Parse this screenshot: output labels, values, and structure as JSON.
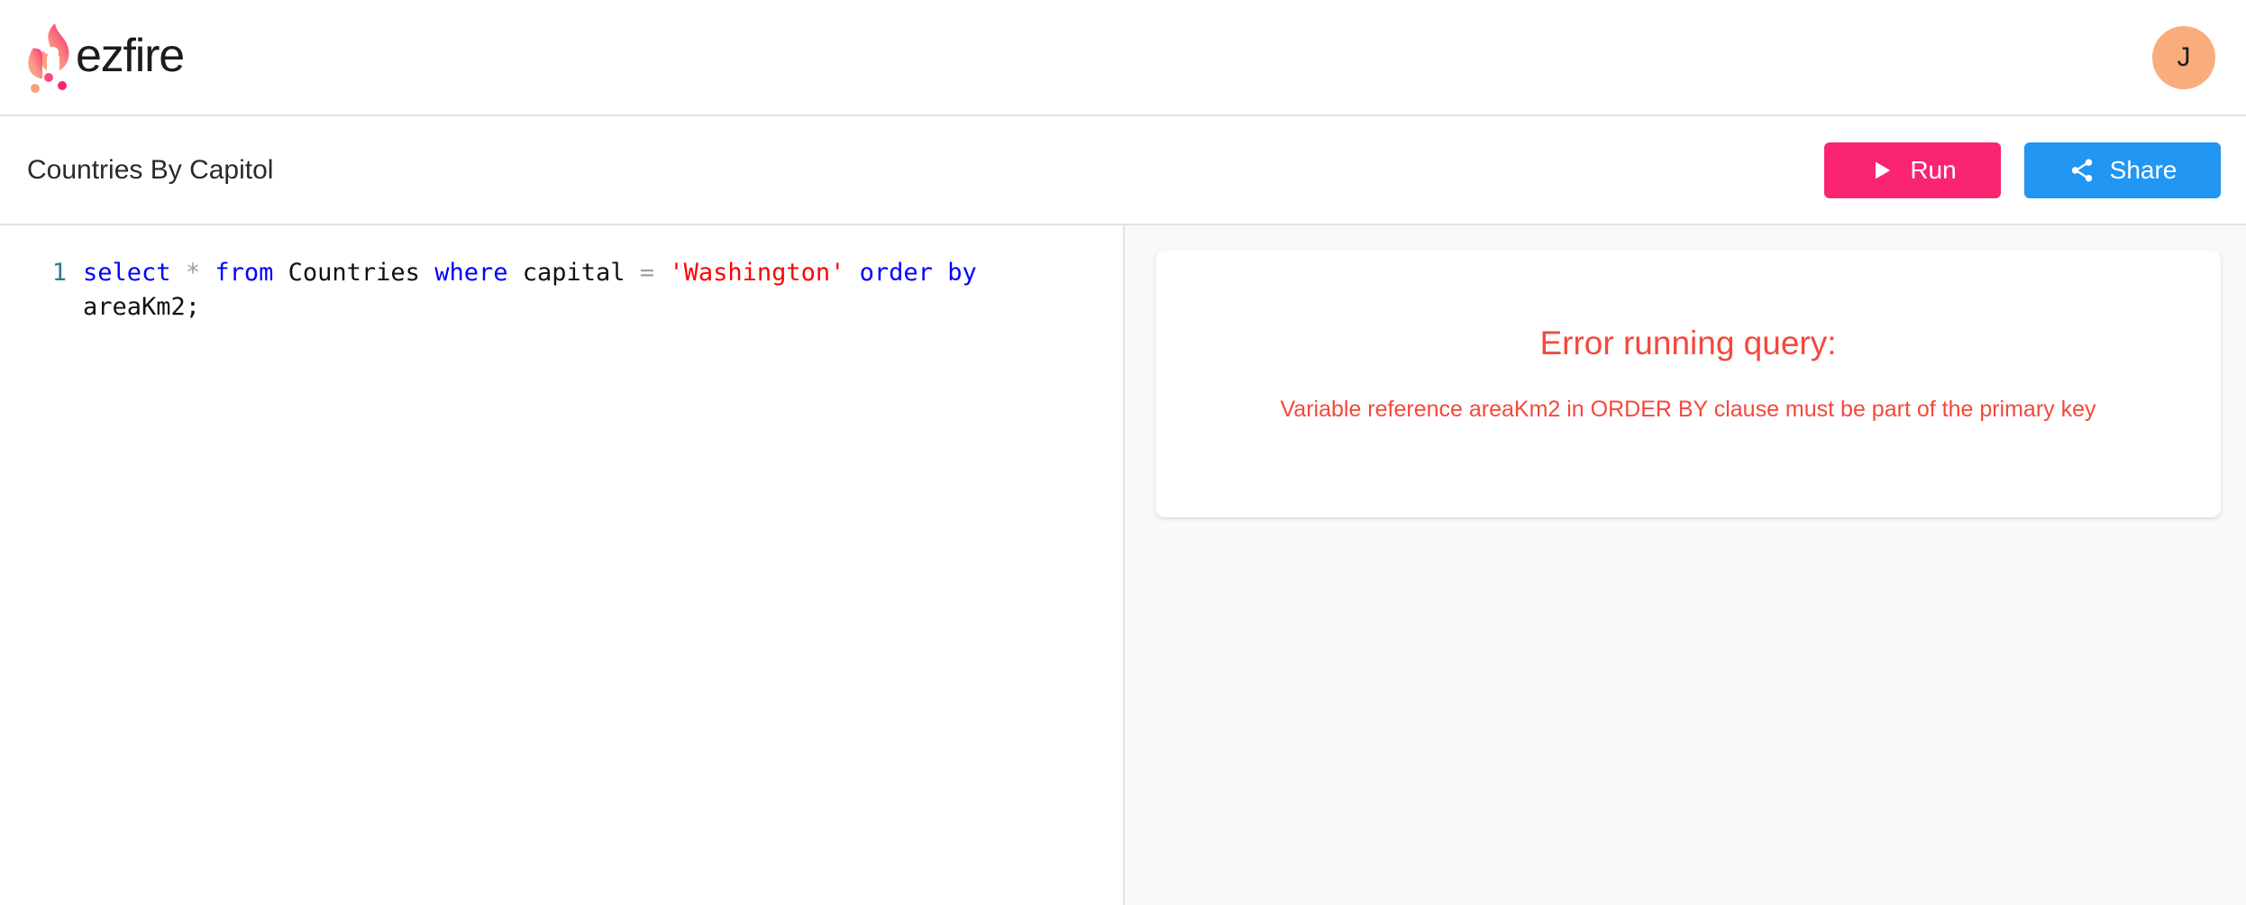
{
  "header": {
    "brand_name": "ezfire",
    "logo_icon": "flame-circuit-icon",
    "avatar_initial": "J",
    "avatar_color": "#f9ac7c"
  },
  "toolbar": {
    "query_title": "Countries By Capitol",
    "run_label": "Run",
    "run_icon": "play-icon",
    "run_color": "#fb2472",
    "share_label": "Share",
    "share_icon": "share-nodes-icon",
    "share_color": "#2196f3"
  },
  "editor": {
    "line_number": "1",
    "line_number_color": "#2c7a94",
    "tokens": [
      {
        "t": "select",
        "k": "kw"
      },
      {
        "t": " ",
        "k": "plain"
      },
      {
        "t": "*",
        "k": "op"
      },
      {
        "t": " ",
        "k": "plain"
      },
      {
        "t": "from",
        "k": "kw"
      },
      {
        "t": " Countries ",
        "k": "id"
      },
      {
        "t": "where",
        "k": "kw"
      },
      {
        "t": " capital ",
        "k": "id"
      },
      {
        "t": "=",
        "k": "op"
      },
      {
        "t": " ",
        "k": "plain"
      },
      {
        "t": "'Washington'",
        "k": "str"
      },
      {
        "t": " ",
        "k": "plain"
      },
      {
        "t": "order",
        "k": "kw"
      },
      {
        "t": " ",
        "k": "plain"
      },
      {
        "t": "by",
        "k": "kw"
      },
      {
        "t": " areaKm2;",
        "k": "id"
      }
    ],
    "plain_text": "select * from Countries where capital = 'Washington' order by areaKm2;"
  },
  "results": {
    "error_title": "Error running query:",
    "error_message": "Variable reference areaKm2 in ORDER BY clause must be part of the primary key",
    "error_color": "#f4483c"
  }
}
